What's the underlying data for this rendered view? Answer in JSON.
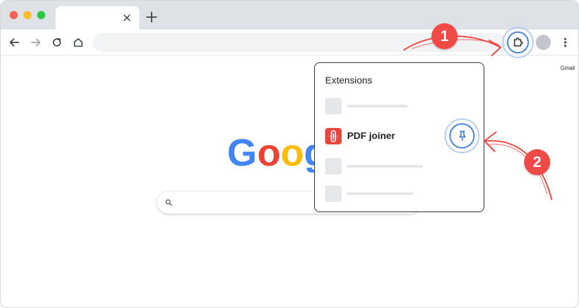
{
  "browser": {
    "tab": {
      "title": "",
      "close_icon": "close-icon"
    },
    "new_tab_icon": "plus-icon",
    "omnibox_value": ""
  },
  "page": {
    "gmail_link": "Gmail",
    "logo_text": "Google",
    "logo_colors": [
      "#4285F4",
      "#EA4335",
      "#FBBC05",
      "#4285F4",
      "#34A853",
      "#EA4335"
    ],
    "search_placeholder": ""
  },
  "extensions_popup": {
    "title": "Extensions",
    "items": [
      {
        "label": "",
        "placeholder": true
      },
      {
        "label": "PDF joiner",
        "placeholder": false,
        "pinnable": true
      },
      {
        "label": "",
        "placeholder": true
      },
      {
        "label": "",
        "placeholder": true
      }
    ]
  },
  "annotations": {
    "step1": "1",
    "step2": "2",
    "color": "#EF4A45",
    "highlight_color": "#4A84D8"
  }
}
